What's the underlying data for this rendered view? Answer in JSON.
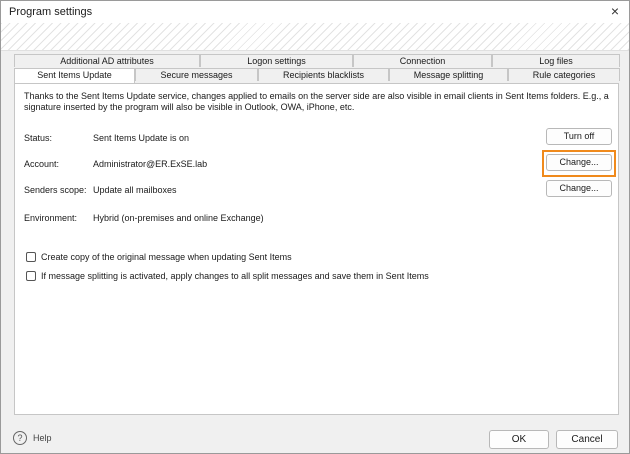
{
  "window": {
    "title": "Program settings",
    "close_glyph": "×"
  },
  "tabs": {
    "row1": [
      "Additional AD attributes",
      "Logon settings",
      "Connection",
      "Log files"
    ],
    "row2": [
      "Sent Items Update",
      "Secure messages",
      "Recipients blacklists",
      "Message splitting",
      "Rule categories"
    ],
    "active": "Sent Items Update"
  },
  "panel": {
    "description": "Thanks to the Sent Items Update service, changes applied to emails on the server side are also visible in email clients in Sent Items folders. E.g., a signature inserted by the program will also be visible in Outlook, OWA, iPhone, etc.",
    "status": {
      "label": "Status:",
      "value": "Sent Items Update is on",
      "button": "Turn off"
    },
    "account": {
      "label": "Account:",
      "value": "Administrator@ER.ExSE.lab",
      "button": "Change..."
    },
    "senders_scope": {
      "label": "Senders scope:",
      "value": "Update all mailboxes",
      "button": "Change..."
    },
    "environment": {
      "label": "Environment:",
      "value": "Hybrid (on-premises and online Exchange)"
    },
    "checkboxes": [
      {
        "label": "Create copy of the original message when updating Sent Items",
        "checked": false
      },
      {
        "label": "If message splitting is activated, apply changes to all split messages and save them in Sent Items",
        "checked": false
      }
    ]
  },
  "footer": {
    "help_glyph": "?",
    "help_label": "Help",
    "ok_label": "OK",
    "cancel_label": "Cancel"
  },
  "colors": {
    "highlight": "#f08a1c"
  }
}
